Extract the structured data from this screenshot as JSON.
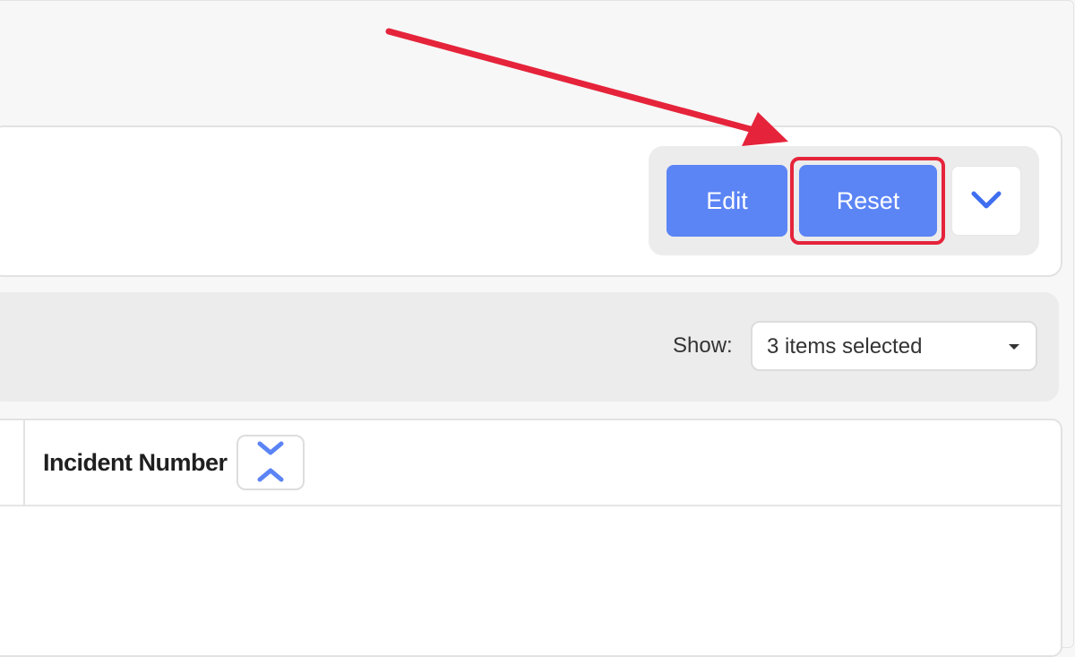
{
  "toolbar": {
    "edit_label": "Edit",
    "reset_label": "Reset",
    "more_icon": "chevron-down-icon"
  },
  "filter": {
    "show_label": "Show:",
    "selected_value": "3 items selected"
  },
  "table": {
    "columns": [
      "Incident Number"
    ],
    "sort_icon": "collapse-expand-icon"
  },
  "annotation": {
    "arrow_color": "#e5243b",
    "highlight_color": "#e5243b",
    "target": "Reset"
  },
  "colors": {
    "accent": "#5b84f5",
    "background": "#f7f7f7"
  }
}
